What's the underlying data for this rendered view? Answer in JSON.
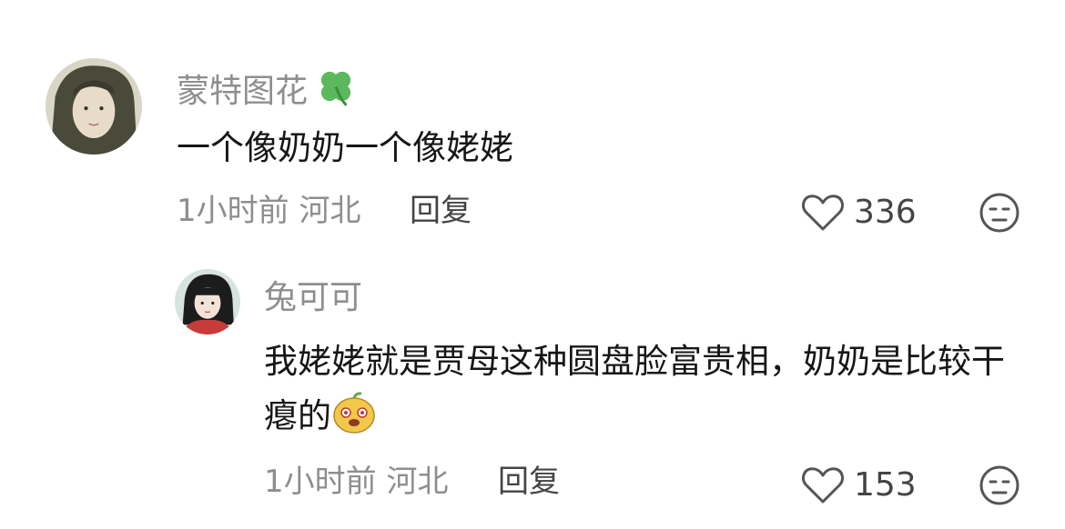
{
  "comments": [
    {
      "username": "蒙特图花",
      "text": "一个像奶奶一个像姥姥",
      "time": "1小时前",
      "location": "河北",
      "reply_label": "回复",
      "likes": "336"
    },
    {
      "username": "兔可可",
      "text": "我姥姥就是贾母这种圆盘脸富贵相，奶奶是比较干瘪的",
      "time": "1小时前",
      "location": "河北",
      "reply_label": "回复",
      "likes": "153"
    }
  ],
  "colors": {
    "username": "#8e8e8e",
    "text": "#161616",
    "meta": "#8e8e8e",
    "action": "#444444",
    "clover": "#5cb85c"
  },
  "icons": {
    "clover": "four-leaf-clover-icon",
    "emoji": "smiling-bun-emoji-icon",
    "like": "heart-outline-icon",
    "dislike": "unamused-face-icon"
  }
}
